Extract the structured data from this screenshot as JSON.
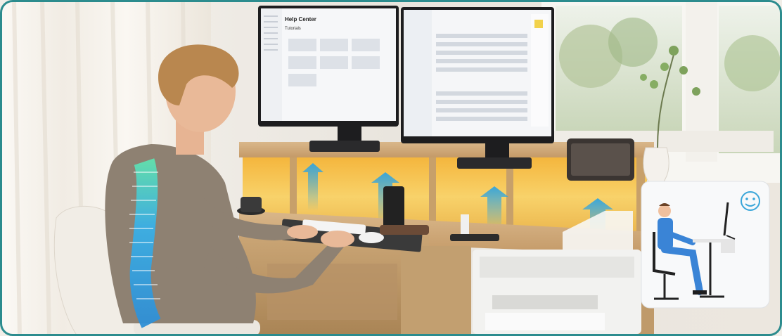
{
  "monitor_left": {
    "app_title": "Help Center",
    "section_label": "Tutorials"
  },
  "icons": {
    "posture_badge": "smiley-face-icon"
  },
  "colors": {
    "frame_border": "#2c8c8e",
    "led_glow": "#f7c84a",
    "posture_arrow": "#3aa6d9",
    "spine": "#3ab0e6"
  }
}
